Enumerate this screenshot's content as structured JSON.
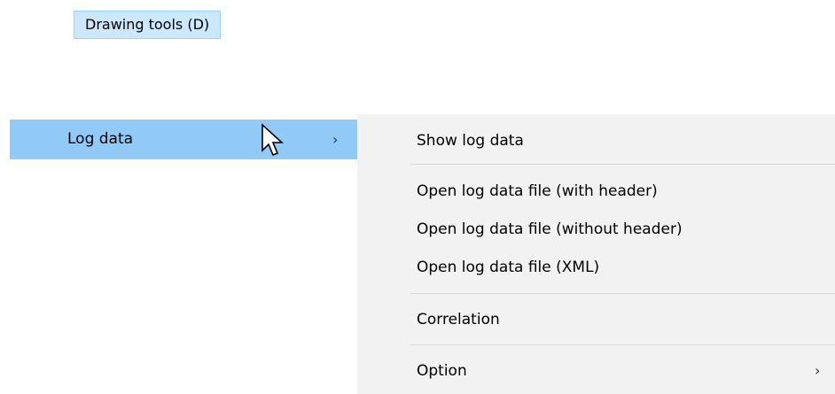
{
  "top_menu": {
    "label": "Drawing tools (D)"
  },
  "parent_menu": {
    "item_label": "Log data",
    "arrow": "›"
  },
  "submenu": {
    "items": [
      {
        "label": "Show log data"
      },
      {
        "label": "Open log data file (with header)"
      },
      {
        "label": "Open log data file (without header)"
      },
      {
        "label": "Open log data file (XML)"
      },
      {
        "label": "Correlation"
      },
      {
        "label": "Option",
        "arrow": "›"
      }
    ]
  },
  "colors": {
    "highlight": "#91c9f7",
    "top_highlight": "#cce8ff",
    "submenu_bg": "#f2f2f2",
    "separator": "#d7d7d7"
  },
  "icons": {
    "cursor": "mouse-pointer-icon",
    "submenu_arrow": "chevron-right-icon"
  }
}
